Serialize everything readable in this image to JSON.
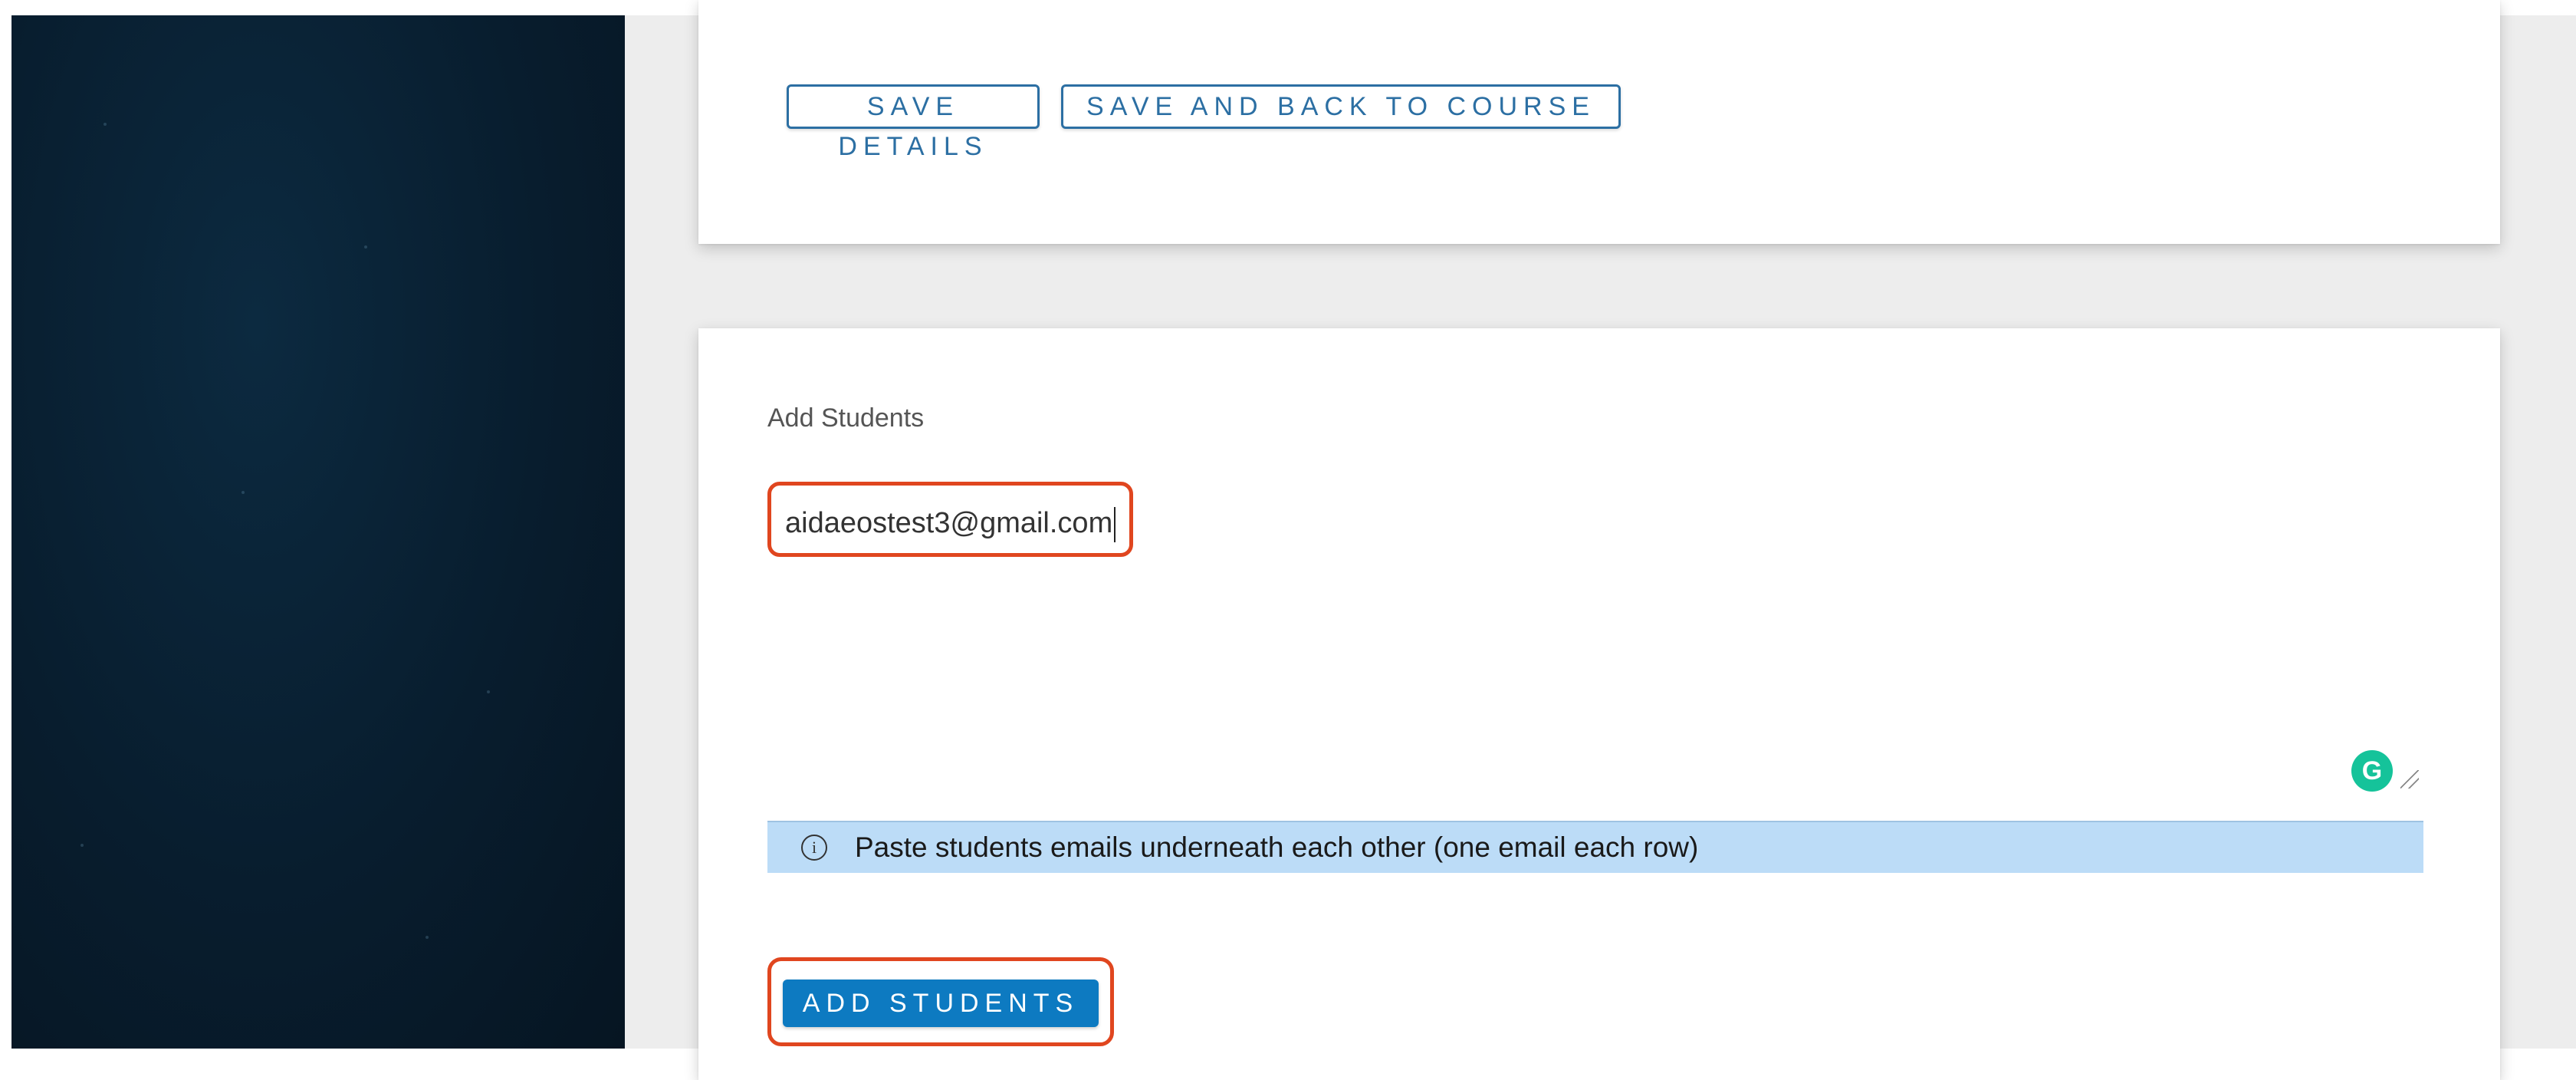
{
  "top_actions": {
    "save_details_label": "SAVE DETAILS",
    "save_back_label": "SAVE AND BACK TO COURSE"
  },
  "add_students": {
    "section_label": "Add Students",
    "textarea_value": "aidaeostest3@gmail.com",
    "grammarly_glyph": "G",
    "info_icon_glyph": "i",
    "info_text": "Paste students emails underneath each other (one email each row)",
    "submit_label": "ADD STUDENTS"
  },
  "colors": {
    "sidebar_bg": "#081d2e",
    "content_bg": "#ededed",
    "accent_blue": "#0d7ac1",
    "outline_blue": "#2c6fa3",
    "info_bg": "#bcdcf7",
    "highlight_red": "#e0461f",
    "grammarly_green": "#15c39a"
  },
  "icons": {
    "info": "info-circle-icon",
    "grammarly": "grammarly-icon",
    "resize": "resize-handle-icon"
  }
}
